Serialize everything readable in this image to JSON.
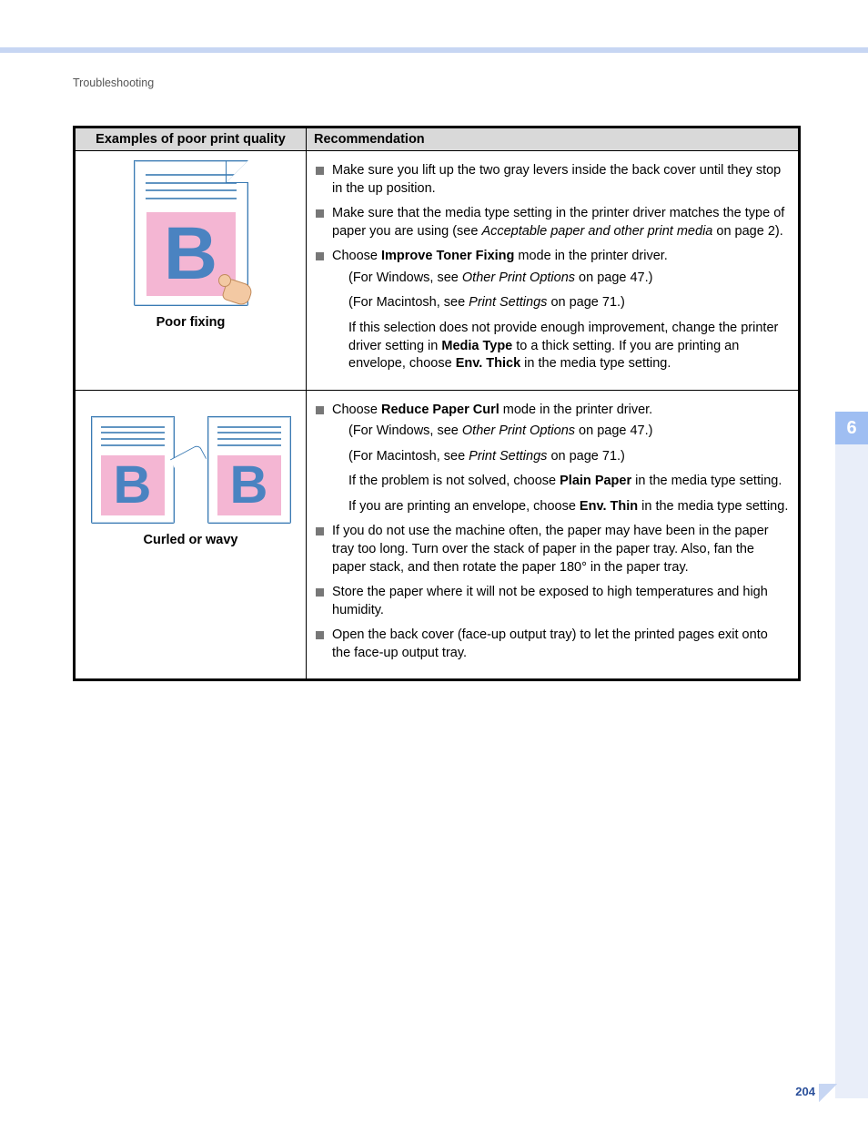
{
  "breadcrumb": "Troubleshooting",
  "table": {
    "headers": {
      "examples": "Examples of poor print quality",
      "recommendation": "Recommendation"
    },
    "row1": {
      "caption": "Poor fixing",
      "items": {
        "i1": "Make sure you lift up the two gray levers inside the back cover until they stop in the up position.",
        "i2a": "Make sure that the media type setting in the printer driver matches the type of paper you are using (see ",
        "i2b": "Acceptable paper and other print media",
        "i2c": " on page 2).",
        "i3a": "Choose ",
        "i3b": "Improve Toner Fixing",
        "i3c": " mode in the printer driver.",
        "s1a": "(For Windows, see ",
        "s1b": "Other Print Options",
        "s1c": " on page 47.)",
        "s2a": "(For Macintosh, see ",
        "s2b": "Print Settings",
        "s2c": " on page 71.)",
        "s3a": "If this selection does not provide enough improvement, change the printer driver setting in ",
        "s3b": "Media Type",
        "s3c": " to a thick setting. If you are printing an envelope, choose ",
        "s3d": "Env. Thick",
        "s3e": " in the media type setting."
      }
    },
    "row2": {
      "caption": "Curled or wavy",
      "items": {
        "i1a": "Choose ",
        "i1b": "Reduce Paper Curl",
        "i1c": " mode in the printer driver.",
        "s1a": "(For Windows, see ",
        "s1b": "Other Print Options",
        "s1c": " on page 47.)",
        "s2a": "(For Macintosh, see ",
        "s2b": "Print Settings",
        "s2c": " on page 71.)",
        "s3a": "If the problem is not solved, choose ",
        "s3b": "Plain Paper",
        "s3c": " in the media type setting.",
        "s4a": "If you are printing an envelope, choose ",
        "s4b": "Env. Thin",
        "s4c": " in the media type setting.",
        "i2": "If you do not use the machine often, the paper may have been in the paper tray too long. Turn over the stack of paper in the paper tray. Also, fan the paper stack, and then rotate the paper 180° in the paper tray.",
        "i3": "Store the paper where it will not be exposed to high temperatures and high humidity.",
        "i4": "Open the back cover (face-up output tray) to let the printed pages exit onto the face-up output tray."
      }
    }
  },
  "chapter_tab": "6",
  "page_number": "204"
}
